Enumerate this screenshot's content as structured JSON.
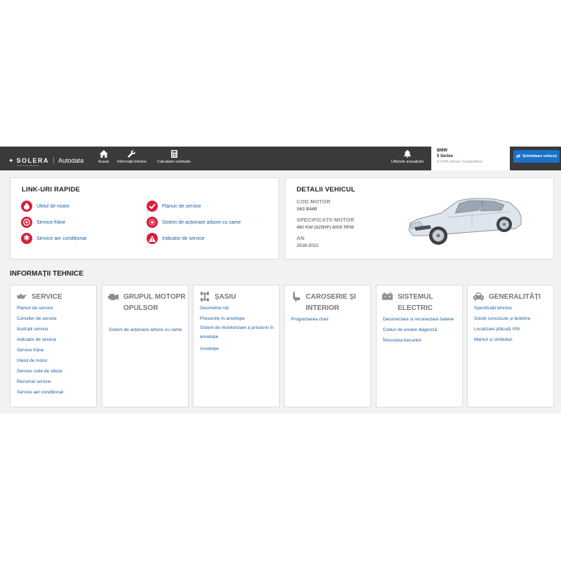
{
  "header": {
    "logo": "SOLERA",
    "logo_sub": "VEHICLE REPAIR",
    "product": "Autodata",
    "nav": [
      {
        "label": "Acasă",
        "icon": "home-icon"
      },
      {
        "label": "Informații tehnice",
        "icon": "wrench-icon"
      },
      {
        "label": "Calculator estimativ",
        "icon": "calculator-icon"
      }
    ],
    "updates_label": "Ultimele actualizări",
    "vehicle": {
      "make": "BMW",
      "model": "5 Series",
      "variant": "4.4 M5 xDrive Competition"
    },
    "change_vehicle_label": "Schimbare vehicul"
  },
  "quick_links": {
    "title": "LINK-URI RAPIDE",
    "left": [
      {
        "label": "Uleiul de motor",
        "icon": "oil-drop-icon"
      },
      {
        "label": "Service frâne",
        "icon": "brake-disc-icon"
      },
      {
        "label": "Service aer condiționat",
        "icon": "snowflake-icon"
      }
    ],
    "right": [
      {
        "label": "Planuri de service",
        "icon": "checkmark-icon"
      },
      {
        "label": "Sistem de acționare arbore cu came",
        "icon": "timing-belt-icon"
      },
      {
        "label": "Indicator de service",
        "icon": "warning-icon"
      }
    ]
  },
  "vehicle_details": {
    "title": "DETALII VEHICUL",
    "fields": [
      {
        "label": "COD MOTOR",
        "value": "S63 B44B"
      },
      {
        "label": "SPECIFICAȚII MOTOR",
        "value": "460 KW (625HP) 6000 RPM"
      },
      {
        "label": "AN",
        "value": "2018-2022"
      }
    ]
  },
  "tech_info": {
    "title": "INFORMAȚII TEHNICE",
    "categories": [
      {
        "title": "SERVICE",
        "icon": "oil-can-icon",
        "links": [
          "Planuri de service",
          "Consilier de service",
          "Ilustrații service",
          "Indicator de service",
          "Service frâne",
          "Uleiul de motor",
          "Service cutie de viteze",
          "Rezumat service",
          "Service aer condiționat"
        ]
      },
      {
        "title": "GRUPUL MOTOPROPULSOR",
        "icon": "engine-icon",
        "links": [
          "Sistem de acționare arbore cu came"
        ]
      },
      {
        "title": "ȘASIU",
        "icon": "chassis-icon",
        "links": [
          "Geometrie roți",
          "Presiunile în anvelope",
          "Sistem de monitorizare a presiunii în anvelope",
          "Anvelope"
        ]
      },
      {
        "title": "CAROSERIE ȘI INTERIOR",
        "icon": "seat-icon",
        "links": [
          "Programarea cheii"
        ]
      },
      {
        "title": "SISTEMUL ELECTRIC",
        "icon": "battery-icon",
        "links": [
          "Deconectare și reconectare baterie",
          "Coduri de eroare diagnoză",
          "Înlocuirea becurilor"
        ]
      },
      {
        "title": "GENERALITĂȚI",
        "icon": "car-icon",
        "links": [
          "Specificații tehnice",
          "Soluții cunoscute și buletine",
          "Localizare plăcuță VIN",
          "Martori și simboluri"
        ]
      }
    ]
  },
  "colors": {
    "topbar": "#3a3a3a",
    "accent": "#1a73c8",
    "icon_red": "#d6213b",
    "link": "#1a5fa8"
  }
}
